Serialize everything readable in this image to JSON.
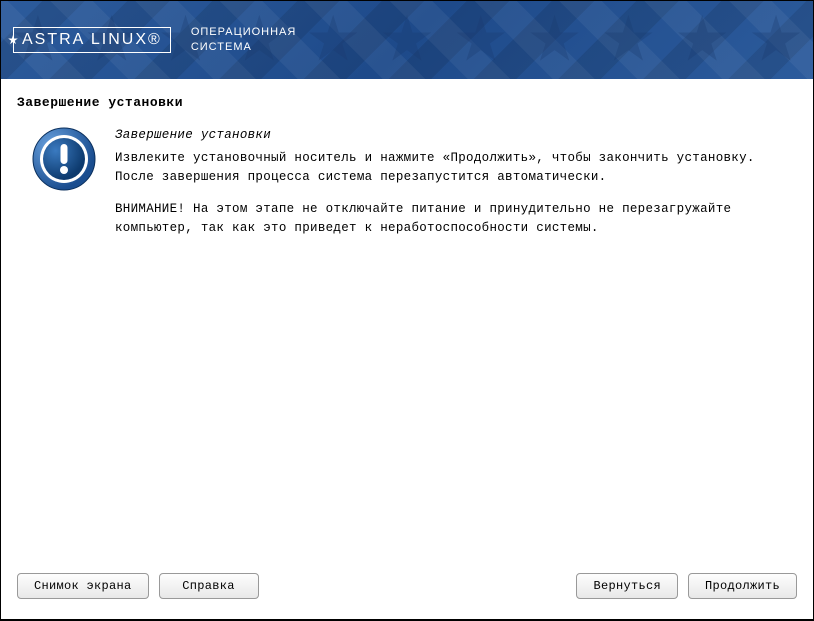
{
  "header": {
    "logo_text": "ASTRA LINUX®",
    "subtitle_line1": "ОПЕРАЦИОННАЯ",
    "subtitle_line2": "СИСТЕМА"
  },
  "page": {
    "title": "Завершение установки",
    "subtitle": "Завершение установки",
    "paragraph1": "Извлеките установочный носитель и нажмите «Продолжить», чтобы закончить установку. После завершения процесса система перезапустится автоматически.",
    "paragraph2": "ВНИМАНИЕ! На этом этапе не отключайте питание и принудительно не перезагружайте компьютер, так как это приведет к неработоспособности системы."
  },
  "buttons": {
    "screenshot": "Снимок экрана",
    "help": "Справка",
    "back": "Вернуться",
    "continue": "Продолжить"
  }
}
